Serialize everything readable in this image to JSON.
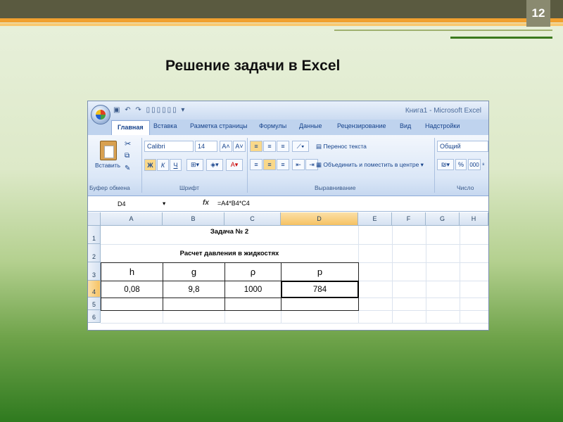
{
  "slide": {
    "page_number": "12",
    "title": "Решение задачи в Excel"
  },
  "excel": {
    "window_title": "Книга1 - Microsoft Excel",
    "tabs": [
      "Главная",
      "Вставка",
      "Разметка страницы",
      "Формулы",
      "Данные",
      "Рецензирование",
      "Вид",
      "Надстройки"
    ],
    "ribbon": {
      "clipboard": {
        "paste_label": "Вставить",
        "group_label": "Буфер обмена"
      },
      "font": {
        "font_name": "Calibri",
        "font_size": "14",
        "bold": "Ж",
        "italic": "К",
        "underline": "Ч",
        "group_label": "Шрифт"
      },
      "alignment": {
        "wrap_text": "Перенос текста",
        "merge_center": "Объединить и поместить в центре",
        "group_label": "Выравнивание"
      },
      "number": {
        "format": "Общий",
        "percent": "%",
        "thousands": "000",
        "group_label": "Число"
      }
    },
    "formula_bar": {
      "name_box": "D4",
      "fx": "fx",
      "formula": "=A4*B4*C4"
    },
    "columns": [
      "A",
      "B",
      "C",
      "D",
      "E",
      "F",
      "G",
      "H"
    ],
    "rows": [
      "1",
      "2",
      "3",
      "4",
      "5",
      "6"
    ],
    "cells": {
      "title1": "Задача № 2",
      "title2": "Расчет давления в жидкостях",
      "headers": [
        "h",
        "g",
        "ρ",
        "p"
      ],
      "values": [
        "0,08",
        "9,8",
        "1000",
        "784"
      ]
    }
  }
}
